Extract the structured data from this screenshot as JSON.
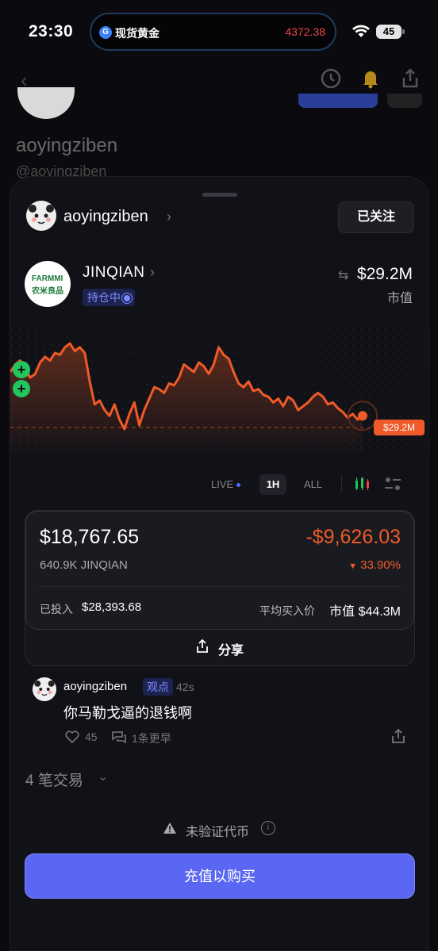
{
  "status_bar": {
    "time": "23:30",
    "island_label": "现货黄金",
    "island_price": "4372.38",
    "battery": "45"
  },
  "background": {
    "username": "aoyingziben",
    "handle": "@aoyingziben"
  },
  "owner": {
    "name": "aoyingziben",
    "follow_label": "已关注"
  },
  "token": {
    "logo_line1": "FARMMI",
    "logo_line2": "农米良品",
    "name": "JINQIAN",
    "holding_label": "持仓中",
    "market_cap_value": "$29.2M",
    "market_cap_label": "市值"
  },
  "chart": {
    "price_tag": "$29.2M",
    "accent": "#f05a28",
    "buy_marker_color": "#22c55e"
  },
  "timeframes": {
    "live": "LIVE",
    "h1": "1H",
    "all": "ALL"
  },
  "position": {
    "value": "$18,767.65",
    "pnl": "-$9,626.03",
    "quantity": "640.9K JINQIAN",
    "pnl_pct": "33.90%",
    "invested_label": "已投入",
    "invested_value": "$28,393.68",
    "avg_label": "平均买入价",
    "avg_value": "市值 $44.3M",
    "share_label": "分享"
  },
  "comment": {
    "user": "aoyingziben",
    "badge": "观点",
    "time": "42s",
    "text": "你马勒戈逼的退钱啊",
    "likes": "45",
    "replies": "1条更早"
  },
  "trades_label": "4 笔交易",
  "warning_text": "未验证代币",
  "buy_label": "充值以购买",
  "chart_data": {
    "type": "line",
    "series": [
      {
        "values": [
          0.7,
          0.78,
          0.82,
          0.74,
          0.64,
          0.68,
          0.8,
          0.86,
          0.82,
          0.9,
          0.88,
          0.96,
          1.0,
          0.92,
          0.96,
          0.9,
          0.6,
          0.36,
          0.4,
          0.3,
          0.24,
          0.36,
          0.2,
          0.1,
          0.26,
          0.38,
          0.14,
          0.3,
          0.42,
          0.54,
          0.52,
          0.48,
          0.58,
          0.56,
          0.64,
          0.78,
          0.74,
          0.7,
          0.8,
          0.76,
          0.68,
          0.78,
          0.96,
          0.88,
          0.84,
          0.7,
          0.58,
          0.54,
          0.6,
          0.5,
          0.52,
          0.46,
          0.44,
          0.38,
          0.42,
          0.34,
          0.44,
          0.4,
          0.3,
          0.34,
          0.38,
          0.44,
          0.48,
          0.44,
          0.36,
          0.38,
          0.32,
          0.28,
          0.22,
          0.26,
          0.2,
          0.24
        ]
      }
    ]
  }
}
